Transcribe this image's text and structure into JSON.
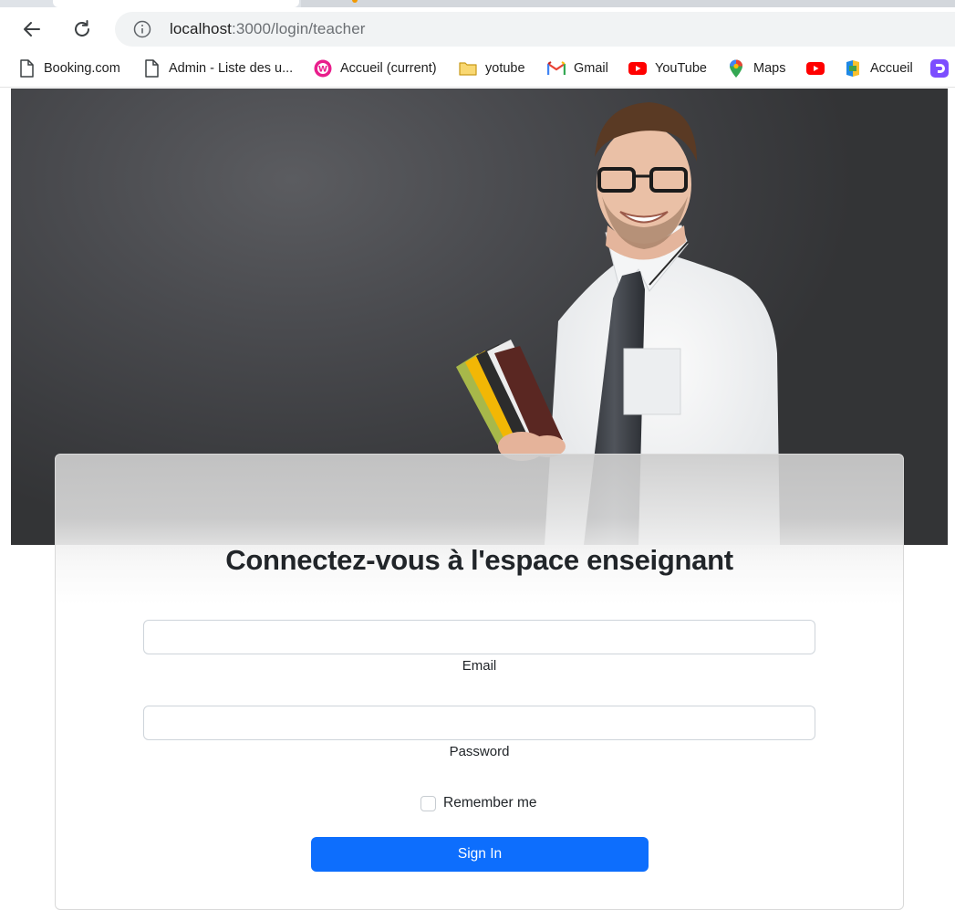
{
  "browser": {
    "url_host": "localhost",
    "url_path": ":3000/login/teacher",
    "bookmarks": [
      {
        "label": "Booking.com",
        "icon": "page-icon"
      },
      {
        "label": "Admin - Liste des u...",
        "icon": "page-icon"
      },
      {
        "label": "Accueil (current)",
        "icon": "wamp-icon"
      },
      {
        "label": "yotube",
        "icon": "folder-icon"
      },
      {
        "label": "Gmail",
        "icon": "gmail-icon"
      },
      {
        "label": "YouTube",
        "icon": "youtube-icon"
      },
      {
        "label": "Maps",
        "icon": "maps-pin-icon"
      },
      {
        "label": "",
        "icon": "youtube-icon"
      },
      {
        "label": "Accueil",
        "icon": "app-icon"
      },
      {
        "label": "",
        "icon": "purple-app-icon"
      }
    ]
  },
  "login": {
    "title": "Connectez-vous à l'espace enseignant",
    "email_label": "Email",
    "email_value": "",
    "password_label": "Password",
    "password_value": "",
    "remember_label": "Remember me",
    "remember_checked": false,
    "submit_label": "Sign In"
  },
  "colors": {
    "primary": "#0d6efd",
    "hero_background": "#444548",
    "page_background": "#ffffff"
  },
  "hero": {
    "image": "teacher-photo"
  }
}
